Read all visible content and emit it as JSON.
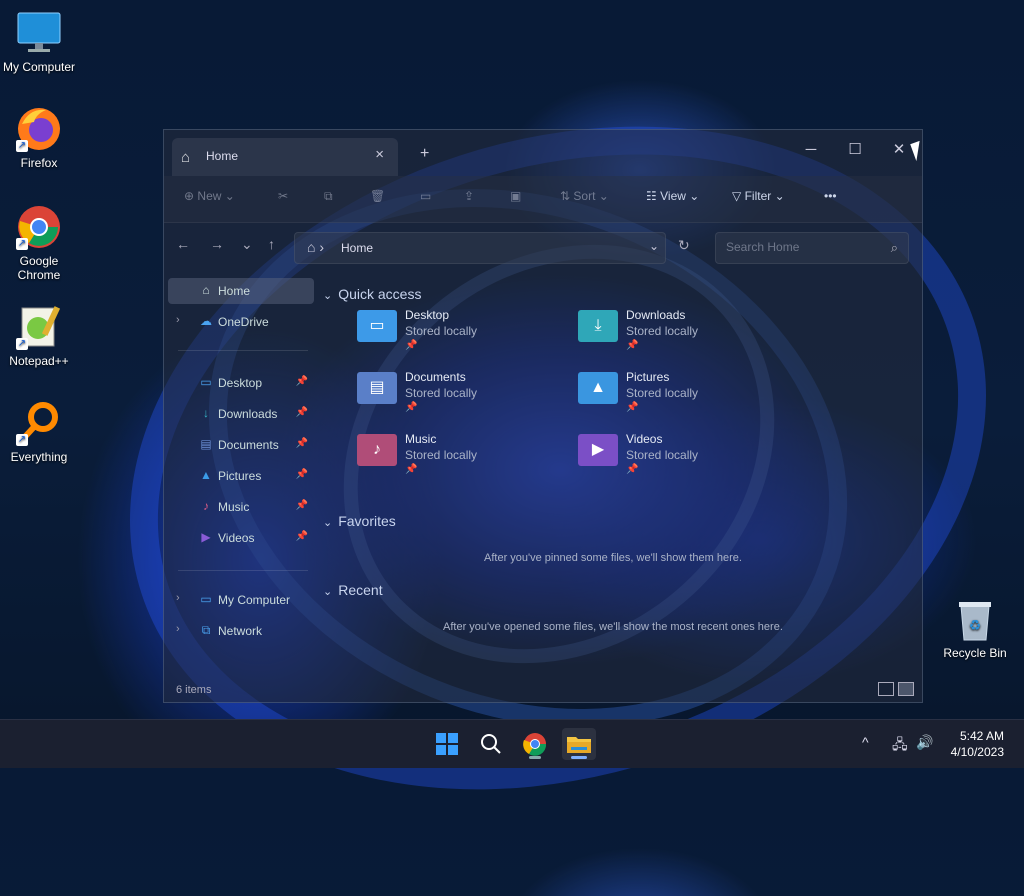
{
  "desktop": {
    "icons": [
      {
        "label": "My Computer"
      },
      {
        "label": "Firefox"
      },
      {
        "label": "Google Chrome"
      },
      {
        "label": "Notepad++"
      },
      {
        "label": "Everything"
      }
    ],
    "recycle_bin": {
      "label": "Recycle Bin"
    }
  },
  "explorer": {
    "tab": {
      "label": "Home",
      "icon": "home-icon"
    },
    "window_controls": {
      "minimize": "─",
      "maximize": "☐",
      "close": "✕"
    },
    "commands": {
      "new": "New",
      "sort": "Sort",
      "view": "View",
      "filter": "Filter",
      "more": "•••"
    },
    "address": {
      "crumb": "Home"
    },
    "search": {
      "placeholder": "Search Home"
    },
    "nav": {
      "top": [
        {
          "label": "Home"
        },
        {
          "label": "OneDrive"
        }
      ],
      "pinned": [
        {
          "label": "Desktop",
          "icon": "desktop-folder-icon",
          "color": "#4aa3f0"
        },
        {
          "label": "Downloads",
          "icon": "download-icon",
          "color": "#36b6c8"
        },
        {
          "label": "Documents",
          "icon": "documents-icon",
          "color": "#6b8fd6"
        },
        {
          "label": "Pictures",
          "icon": "pictures-icon",
          "color": "#3b9be8"
        },
        {
          "label": "Music",
          "icon": "music-icon",
          "color": "#d65b86"
        },
        {
          "label": "Videos",
          "icon": "videos-icon",
          "color": "#8a5bd6"
        }
      ],
      "bottom": [
        {
          "label": "My Computer"
        },
        {
          "label": "Network"
        }
      ]
    },
    "sections": {
      "quick_access": "Quick access",
      "favorites": "Favorites",
      "recent": "Recent"
    },
    "quick_access_items": [
      {
        "name": "Desktop",
        "sub": "Stored locally",
        "color": "#3d9ae8"
      },
      {
        "name": "Downloads",
        "sub": "Stored locally",
        "color": "#2fa7b8"
      },
      {
        "name": "Documents",
        "sub": "Stored locally",
        "color": "#5a7fc8"
      },
      {
        "name": "Pictures",
        "sub": "Stored locally",
        "color": "#3a96e0"
      },
      {
        "name": "Music",
        "sub": "Stored locally",
        "color": "#b04d78"
      },
      {
        "name": "Videos",
        "sub": "Stored locally",
        "color": "#7b4fc6"
      }
    ],
    "favorites_empty": "After you've pinned some files, we'll show them here.",
    "recent_empty": "After you've opened some files, we'll show the most recent ones here.",
    "status": {
      "count": "6 items"
    }
  },
  "taskbar": {
    "apps": [
      {
        "name": "start",
        "icon": "windows-start-icon"
      },
      {
        "name": "search",
        "icon": "search-icon"
      },
      {
        "name": "chrome",
        "icon": "chrome-icon"
      },
      {
        "name": "file-explorer",
        "icon": "file-explorer-icon"
      }
    ],
    "tray": {
      "chevron": "^"
    },
    "clock": {
      "time": "5:42 AM",
      "date": "4/10/2023"
    }
  }
}
